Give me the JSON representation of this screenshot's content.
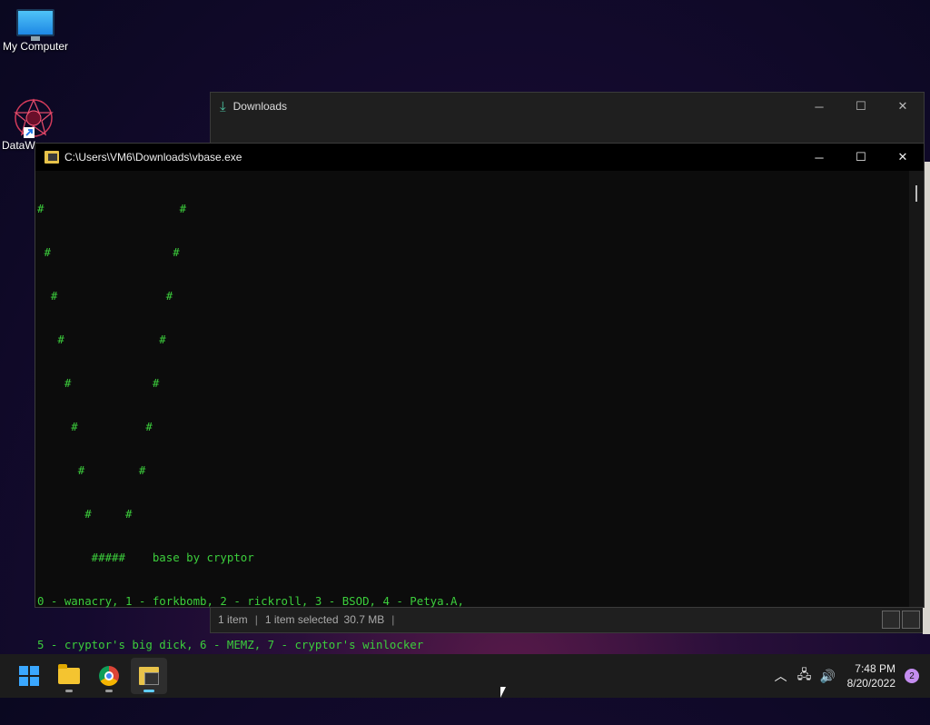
{
  "desktop": {
    "icons": [
      {
        "label": "My Computer",
        "icon": "monitor-icon"
      },
      {
        "label": "DataW",
        "icon": "datawipe-icon"
      }
    ]
  },
  "explorer": {
    "title": "Downloads",
    "status": {
      "items": "1 item",
      "selected": "1 item selected",
      "size": "30.7 MB"
    }
  },
  "console": {
    "title": "C:\\Users\\VM6\\Downloads\\vbase.exe",
    "lines": [
      "#                    #",
      " #                  #",
      "  #                #",
      "   #              #",
      "    #            #",
      "     #          #",
      "      #        #",
      "       #     #",
      "        #####    base by cryptor",
      "0 - wanacry, 1 - forkbomb, 2 - rickroll, 3 - BSOD, 4 - Petya.A,",
      "5 - cryptor's big dick, 6 - MEMZ, 7 - cryptor's winlocker",
      ">>>"
    ]
  },
  "taskbar": {
    "apps": [
      "start-button",
      "file-explorer",
      "chrome",
      "vbase-console"
    ],
    "clock": {
      "time": "7:48 PM",
      "date": "8/20/2022"
    },
    "notification_count": "2"
  },
  "colors": {
    "terminal_text": "#3cce3c",
    "accent": "#60cdff"
  }
}
